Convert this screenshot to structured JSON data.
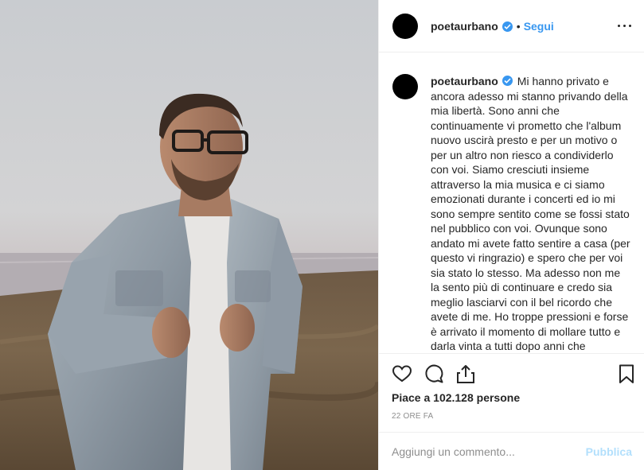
{
  "post": {
    "username": "poetaurbano",
    "separator": "•",
    "follow_label": "Segui",
    "more_icon": "more-options-icon",
    "verified_icon": "verified-badge-icon",
    "caption_text": "Mi hanno privato e ancora adesso mi stanno privando della mia libertà. Sono anni che continuamente vi prometto che l'album nuovo uscirà presto e per un motivo o per un altro non riesco a condividerlo con voi. Siamo cresciuti insieme attraverso la mia musica e ci siamo emozionati durante i concerti ed io mi sono sempre sentito come se fossi stato nel pubblico con voi. Ovunque sono andato mi avete fatto sentire a casa (per questo vi ringrazio) e spero che per voi sia stato lo stesso. Ma adesso non me la sento più di continuare e credo sia meglio lasciarvi con il bel ricordo che avete di me. Ho troppe pressioni e forse è arrivato il momento di mollare tutto e darla vinta a tutti dopo anni che",
    "likes_text": "Piace a 102.128 persone",
    "time_text": "22 ORE FA"
  },
  "actions": {
    "like_icon": "heart-icon",
    "comment_icon": "comment-icon",
    "share_icon": "share-icon",
    "save_icon": "bookmark-icon"
  },
  "comment": {
    "placeholder": "Aggiungi un commento...",
    "submit_label": "Pubblica"
  },
  "colors": {
    "accent": "#3897f0",
    "disabled_accent": "#b2dffc",
    "text": "#262626",
    "muted": "#8e8e8e",
    "border": "#efefef"
  }
}
